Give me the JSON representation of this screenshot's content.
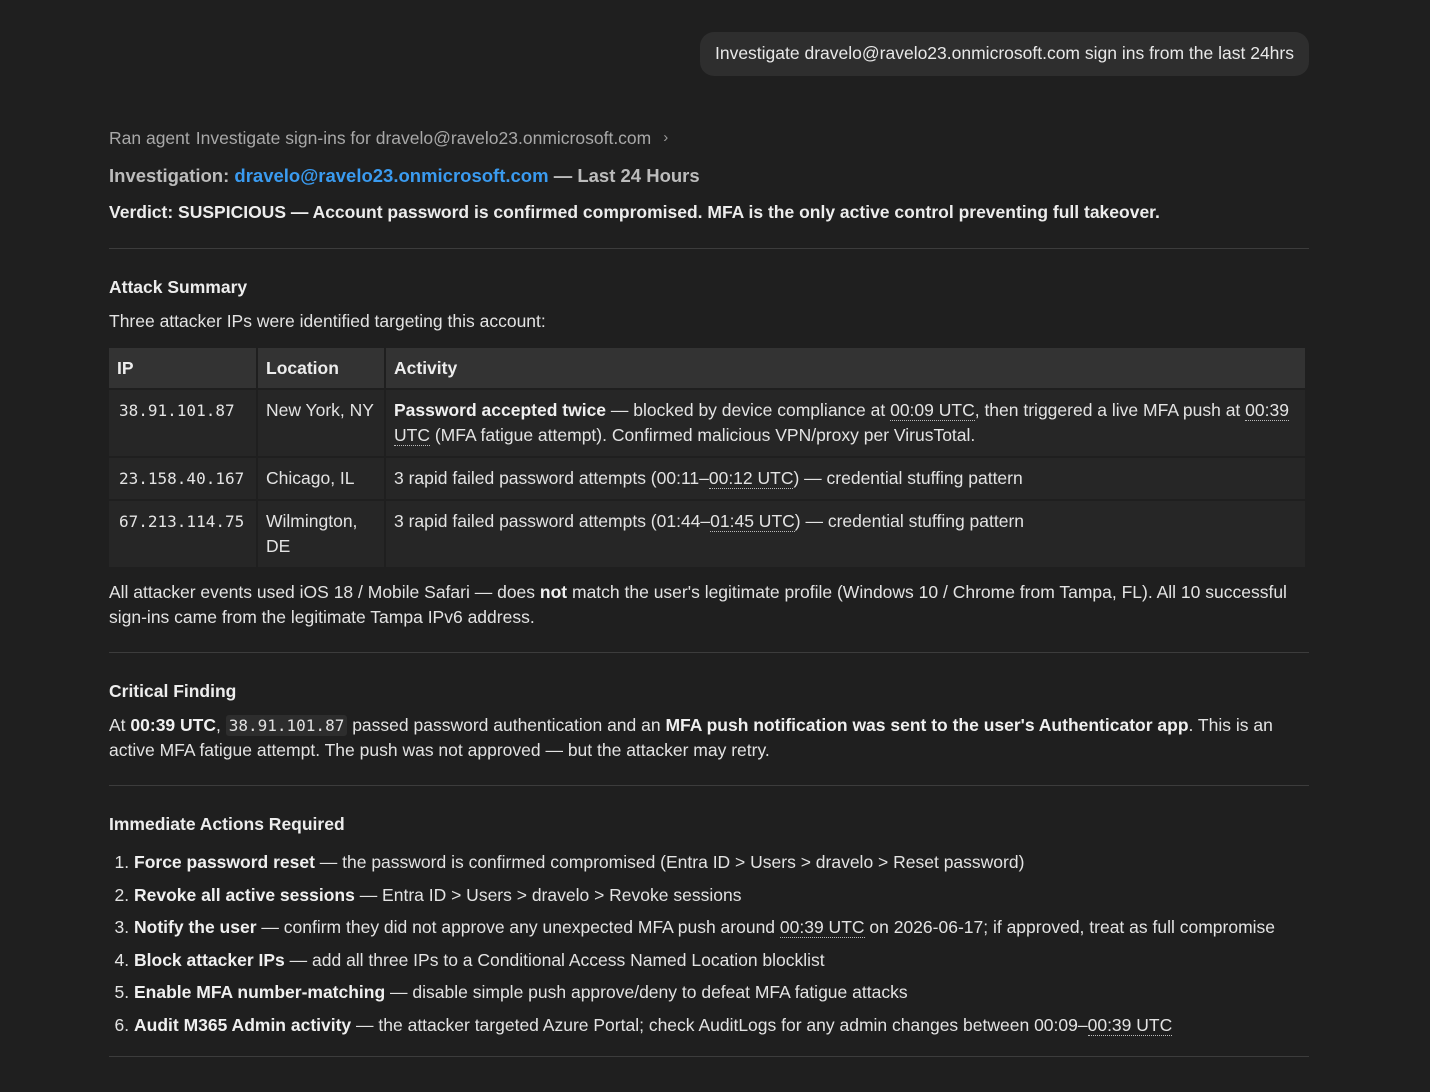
{
  "user_message": "Investigate dravelo@ravelo23.onmicrosoft.com sign ins from the last 24hrs",
  "agent_line": {
    "prefix": "Ran agent",
    "agent_name": "Investigate sign-ins for dravelo@ravelo23.onmicrosoft.com",
    "chevron": "›"
  },
  "investigation": {
    "label": "Investigation:",
    "email": "dravelo@ravelo23.onmicrosoft.com",
    "suffix": "— Last 24 Hours"
  },
  "verdict": "Verdict: SUSPICIOUS — Account password is confirmed compromised. MFA is the only active control preventing full takeover.",
  "attack_summary": {
    "heading": "Attack Summary",
    "intro": "Three attacker IPs were identified targeting this account:",
    "columns": [
      "IP",
      "Location",
      "Activity"
    ],
    "rows": [
      {
        "ip": "38.91.101.87",
        "location": "New York, NY",
        "activity_bold": "Password accepted twice",
        "activity_a": " — blocked by device compliance at ",
        "activity_t1": "00:09 UTC",
        "activity_b": ", then triggered a live MFA push at ",
        "activity_t2": "00:39 UTC",
        "activity_c": " (MFA fatigue attempt). Confirmed malicious VPN/proxy per VirusTotal."
      },
      {
        "ip": "23.158.40.167",
        "location": "Chicago, IL",
        "activity_a": "3 rapid failed password attempts (00:11–",
        "activity_t1": "00:12 UTC",
        "activity_b": ") — credential stuffing pattern"
      },
      {
        "ip": "67.213.114.75",
        "location": "Wilmington, DE",
        "activity_a": "3 rapid failed password attempts (01:44–",
        "activity_t1": "01:45 UTC",
        "activity_b": ") — credential stuffing pattern"
      }
    ],
    "footer_a": "All attacker events used iOS 18 / Mobile Safari — does ",
    "footer_bold": "not",
    "footer_b": " match the user's legitimate profile (Windows 10 / Chrome from Tampa, FL). All 10 successful sign-ins came from the legitimate Tampa IPv6 address."
  },
  "critical_finding": {
    "heading": "Critical Finding",
    "a": "At ",
    "time_bold": "00:39 UTC",
    "b": ", ",
    "ip": "38.91.101.87",
    "c": " passed password authentication and an ",
    "bold": "MFA push notification was sent to the user's Authenticator app",
    "d": ". This is an active MFA fatigue attempt. The push was not approved — but the attacker may retry."
  },
  "actions": {
    "heading": "Immediate Actions Required",
    "items": [
      {
        "bold": "Force password reset",
        "text": " — the password is confirmed compromised (Entra ID > Users > dravelo > Reset password)"
      },
      {
        "bold": "Revoke all active sessions",
        "text": " — Entra ID > Users > dravelo > Revoke sessions"
      },
      {
        "bold": "Notify the user",
        "text_a": " — confirm they did not approve any unexpected MFA push around ",
        "time": "00:39 UTC",
        "text_b": " on 2026-06-17; if approved, treat as full compromise"
      },
      {
        "bold": "Block attacker IPs",
        "text": " — add all three IPs to a Conditional Access Named Location blocklist"
      },
      {
        "bold": "Enable MFA number-matching",
        "text": " — disable simple push approve/deny to defeat MFA fatigue attacks"
      },
      {
        "bold": "Audit M365 Admin activity",
        "text_a": " — the attacker targeted Azure Portal; check AuditLogs for any admin changes between 00:09–",
        "time": "00:39 UTC",
        "text_b": ""
      }
    ]
  }
}
